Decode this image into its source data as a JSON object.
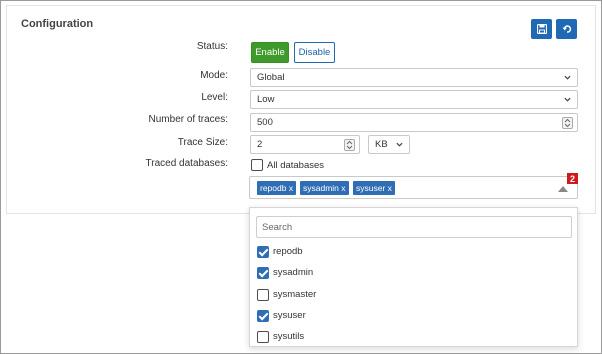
{
  "panel": {
    "title": "Configuration"
  },
  "toolbar": {
    "save_icon": "save-icon",
    "reset_icon": "undo-icon"
  },
  "status": {
    "label": "Status:",
    "enable_label": "Enable",
    "disable_label": "Disable",
    "active": "Enable"
  },
  "mode": {
    "label": "Mode:",
    "value": "Global"
  },
  "level": {
    "label": "Level:",
    "value": "Low"
  },
  "traces": {
    "label": "Number of traces:",
    "value": "500"
  },
  "trace_size": {
    "label": "Trace Size:",
    "value": "2",
    "unit": "KB"
  },
  "databases": {
    "label": "Traced databases:",
    "all_label": "All databases",
    "all_checked": false,
    "selected_tags": [
      "repodb x",
      "sysadmin x",
      "sysuser x"
    ],
    "count_badge": "2",
    "search_placeholder": "Search",
    "options": [
      {
        "label": "repodb",
        "checked": true
      },
      {
        "label": "sysadmin",
        "checked": true
      },
      {
        "label": "sysmaster",
        "checked": false
      },
      {
        "label": "sysuser",
        "checked": true
      },
      {
        "label": "sysutils",
        "checked": false
      }
    ]
  },
  "colors": {
    "primary": "#1f69b5",
    "success": "#3f9a2c",
    "danger": "#d0191a",
    "tag": "#2f6db5"
  }
}
